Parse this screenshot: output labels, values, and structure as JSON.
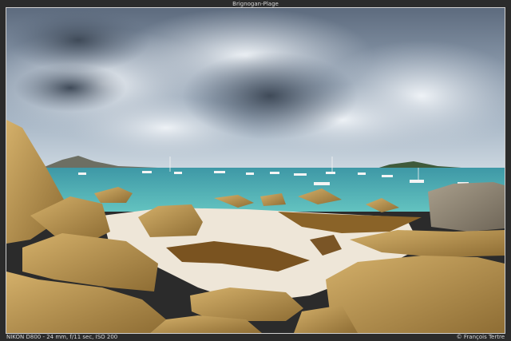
{
  "header": {
    "title": "Brignogan-Plage"
  },
  "footer": {
    "camera_info": "NIKON D800 - 24 mm, f/11 sec, ISO 200",
    "credit": "© François Tertre"
  },
  "colors": {
    "frame": "#2b2b2b",
    "sky_top": "#6f7f92",
    "sky_horizon": "#c9d5df",
    "sea": "#4fb3b8",
    "sand": "#efe8dc",
    "rock": "#b9954f",
    "seaweed": "#7a5a22"
  }
}
